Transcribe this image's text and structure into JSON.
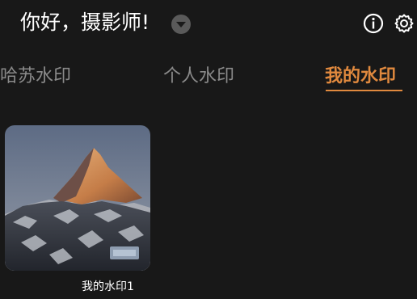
{
  "header": {
    "greeting": "你好，摄影师!",
    "dropdown_icon": "chevron-down-icon",
    "info_icon": "info-icon",
    "settings_icon": "gear-icon"
  },
  "tabs": [
    {
      "label": "哈苏水印",
      "active": false
    },
    {
      "label": "个人水印",
      "active": false
    },
    {
      "label": "我的水印",
      "active": true
    }
  ],
  "watermarks": [
    {
      "label": "我的水印1",
      "thumbnail": "mountain-peak-photo"
    }
  ],
  "colors": {
    "background": "#181818",
    "accent": "#e0893e",
    "tab_inactive": "#8a8a8a",
    "text": "#ffffff"
  }
}
